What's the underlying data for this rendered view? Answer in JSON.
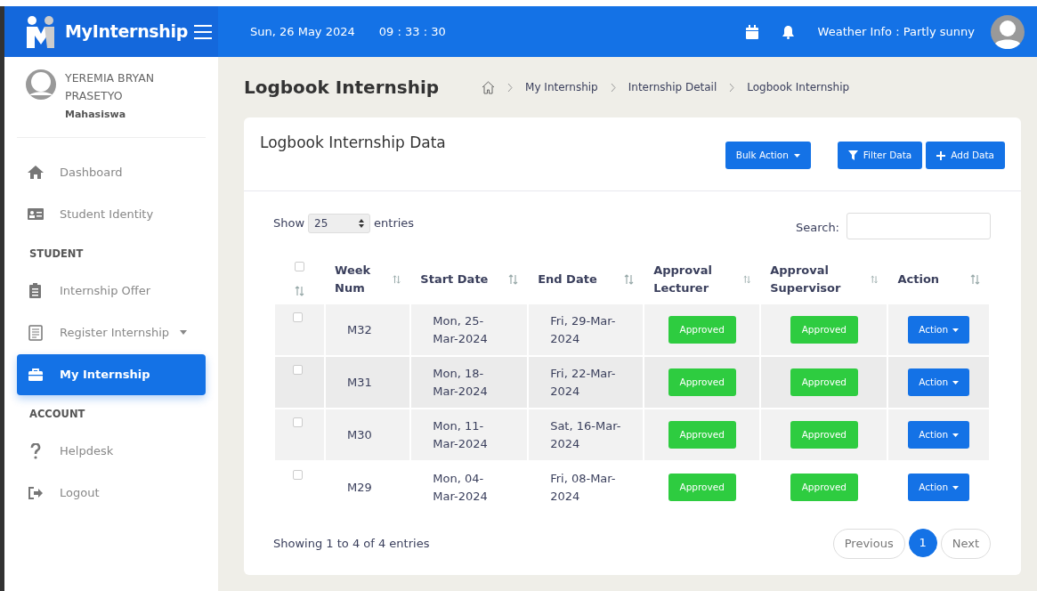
{
  "header": {
    "brand": "MyInternship",
    "date": "Sun, 26 May 2024",
    "time": "09 : 33 : 30",
    "weather": "Weather Info : Partly sunny"
  },
  "user": {
    "name": "YEREMIA BRYAN PRASETYO",
    "role": "Mahasiswa"
  },
  "sidebar": {
    "items": [
      {
        "kind": "link",
        "label": "Dashboard",
        "selected": false
      },
      {
        "kind": "link",
        "label": "Student Identity",
        "selected": false
      },
      {
        "kind": "section",
        "label": "STUDENT"
      },
      {
        "kind": "link",
        "label": "Internship Offer",
        "selected": false
      },
      {
        "kind": "link",
        "label": "Register Internship",
        "selected": false,
        "dropdown": true
      },
      {
        "kind": "link",
        "label": "My Internship",
        "selected": true
      },
      {
        "kind": "section",
        "label": "ACCOUNT"
      },
      {
        "kind": "link",
        "label": "Helpdesk",
        "selected": false
      },
      {
        "kind": "link",
        "label": "Logout",
        "selected": false
      }
    ]
  },
  "page": {
    "title": "Logbook Internship",
    "breadcrumb": [
      "My Internship",
      "Internship Detail",
      "Logbook Internship"
    ]
  },
  "card": {
    "title": "Logbook Internship Data",
    "buttons": [
      {
        "kind": "dropdown",
        "label": "Bulk Action"
      },
      {
        "kind": "filter",
        "label": "Filter Data"
      },
      {
        "kind": "add",
        "label": "Add Data"
      }
    ]
  },
  "table": {
    "show_label": "Show",
    "length": "25",
    "entries_label": "entries",
    "search_label": "Search:",
    "header_checked": false,
    "columns": [
      "Week Num",
      "Start Date",
      "End Date",
      "Approval Lecturer",
      "Approval Supervisor",
      "Action"
    ],
    "rows": [
      {
        "checked": false,
        "week": "M32",
        "start": "Mon, 25-Mar-2024",
        "end": "Fri, 29-Mar-2024",
        "lecturer": "Approved",
        "supervisor": "Approved",
        "action": "Action"
      },
      {
        "checked": false,
        "week": "M31",
        "start": "Mon, 18-Mar-2024",
        "end": "Fri, 22-Mar-2024",
        "lecturer": "Approved",
        "supervisor": "Approved",
        "action": "Action"
      },
      {
        "checked": false,
        "week": "M30",
        "start": "Mon, 11-Mar-2024",
        "end": "Sat, 16-Mar-2024",
        "lecturer": "Approved",
        "supervisor": "Approved",
        "action": "Action"
      },
      {
        "checked": false,
        "week": "M29",
        "start": "Mon, 04-Mar-2024",
        "end": "Fri, 08-Mar-2024",
        "lecturer": "Approved",
        "supervisor": "Approved",
        "action": "Action"
      }
    ],
    "info": "Showing 1 to 4 of 4 entries",
    "pagination": [
      {
        "label": "Previous",
        "selected": false
      },
      {
        "label": "1",
        "selected": true
      },
      {
        "label": "Next",
        "selected": false
      }
    ]
  }
}
